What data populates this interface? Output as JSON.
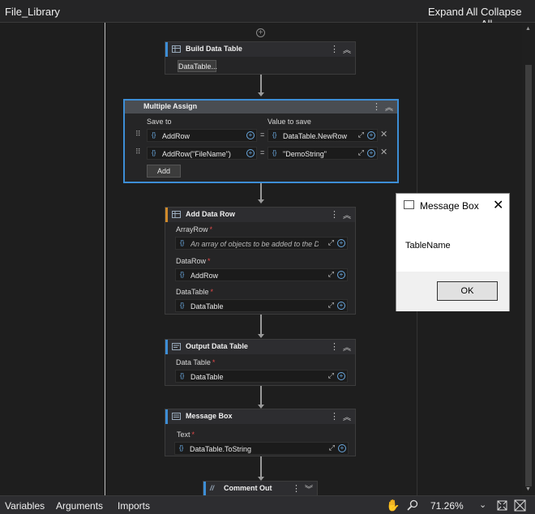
{
  "header": {
    "title": "File_Library",
    "expand_all": "Expand All",
    "collapse_all": "Collapse All"
  },
  "canvas": {
    "add_icon": "plus-circle-icon",
    "build_data_table": {
      "name": "Build Data Table",
      "button": "DataTable..."
    },
    "multiple_assign": {
      "name": "Multiple Assign",
      "save_to_label": "Save to",
      "value_label": "Value to save",
      "rows": [
        {
          "save_to": "AddRow",
          "value": "DataTable.NewRow"
        },
        {
          "save_to": "AddRow(\"FileName\")",
          "value": "\"DemoString\""
        }
      ],
      "add_button": "Add"
    },
    "add_data_row": {
      "name": "Add Data Row",
      "array_row_label": "ArrayRow",
      "array_row_placeholder": "An array of objects to be added to the Da",
      "data_row_label": "DataRow",
      "data_row_value": "AddRow",
      "data_table_label": "DataTable",
      "data_table_value": "DataTable"
    },
    "output_data_table": {
      "name": "Output Data Table",
      "data_table_label": "Data Table",
      "data_table_value": "DataTable"
    },
    "message_box_activity": {
      "name": "Message Box",
      "text_label": "Text",
      "text_value": "DataTable.ToString"
    },
    "comment_out": {
      "name": "Comment Out"
    }
  },
  "dialog": {
    "title": "Message Box",
    "message": "TableName",
    "ok_label": "OK"
  },
  "footer": {
    "tabs": [
      "Variables",
      "Arguments",
      "Imports"
    ],
    "zoom": "71.26%"
  },
  "colors": {
    "accent_blue": "#3d8ed6",
    "accent_orange": "#d08a2a",
    "background": "#1e1e1e"
  }
}
